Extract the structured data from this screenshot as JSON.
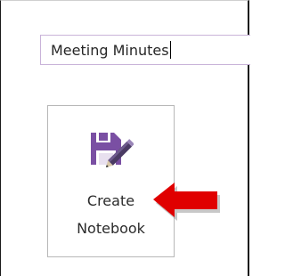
{
  "notebook_name_input": {
    "value": "Meeting Minutes"
  },
  "create_button": {
    "label_line1": "Create",
    "label_line2": "Notebook",
    "icon": "notebook-save-icon"
  },
  "annotation": {
    "icon": "red-arrow-left-icon",
    "color": "#e00000"
  },
  "colors": {
    "icon_purple": "#7a4fa3",
    "input_border": "#c9b3d9"
  }
}
